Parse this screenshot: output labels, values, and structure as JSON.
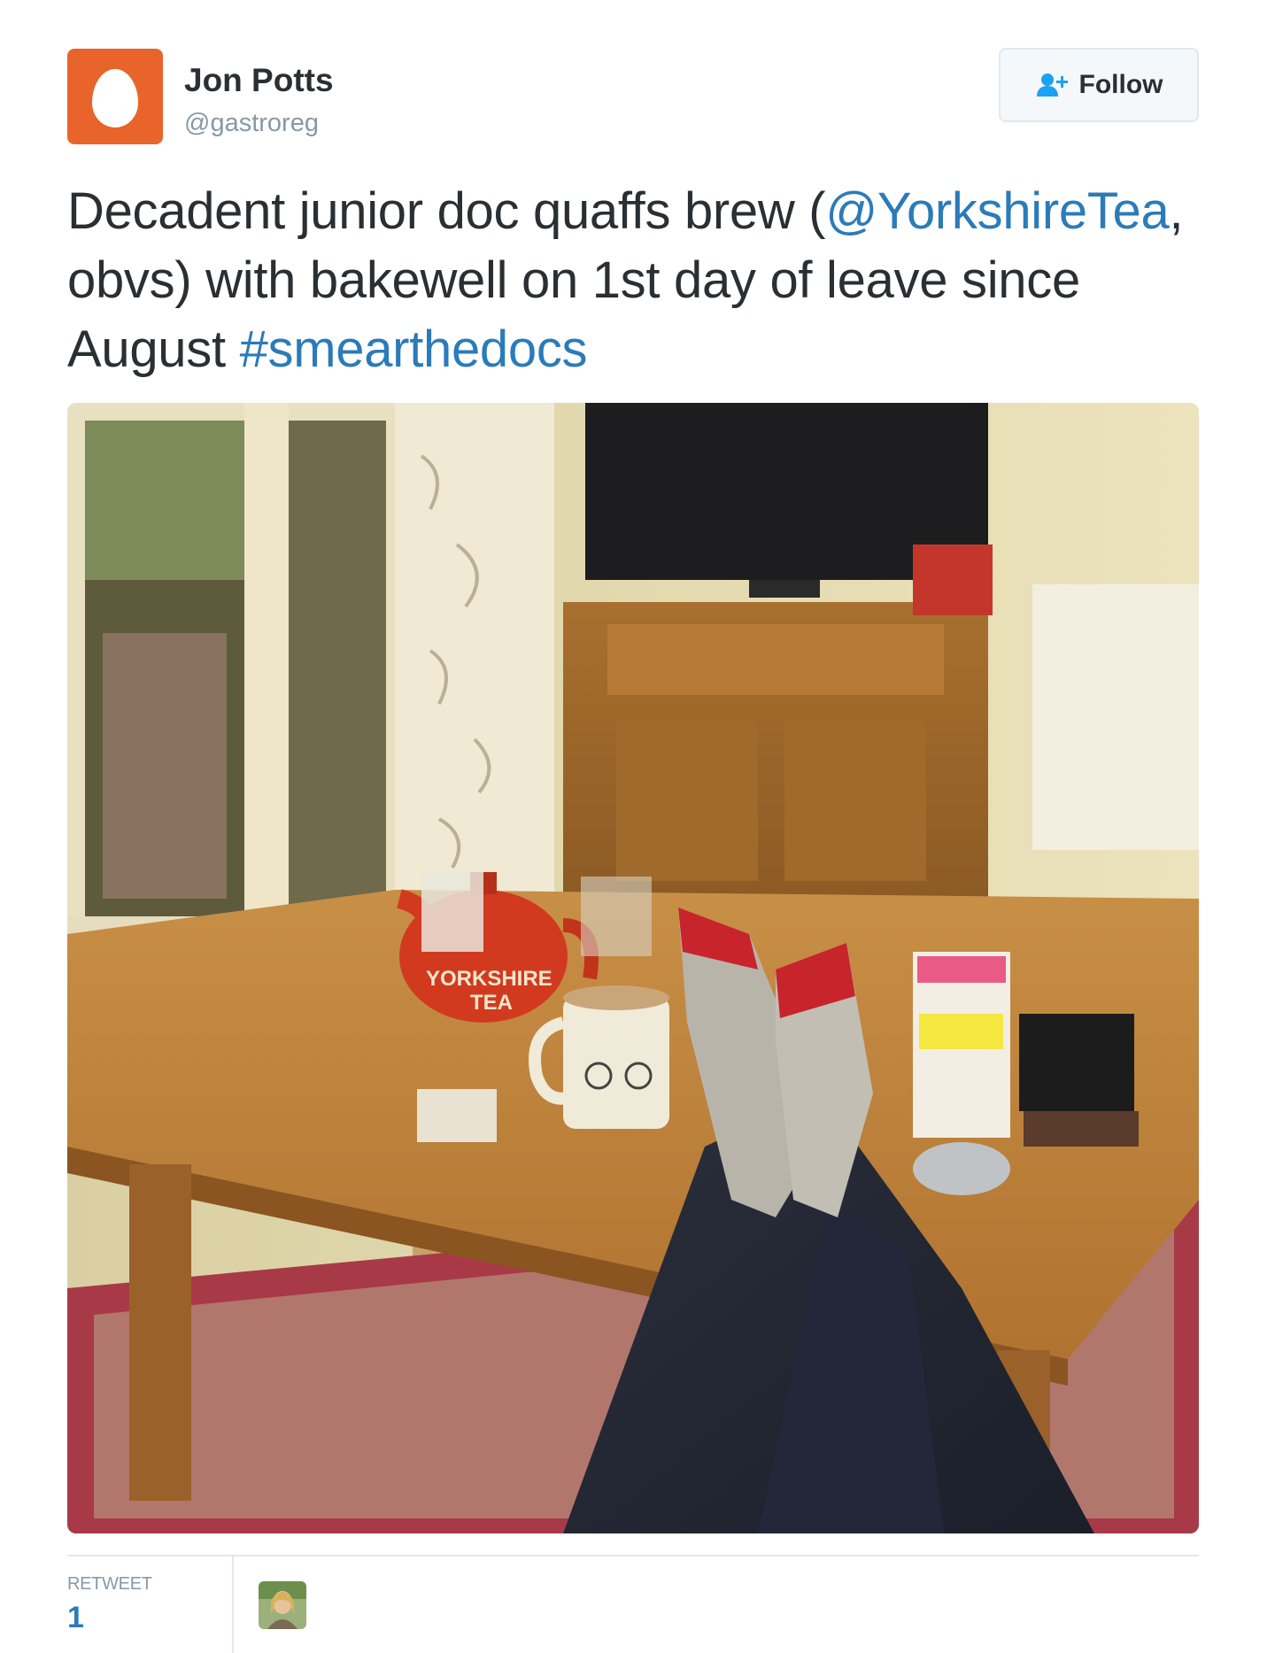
{
  "author": {
    "name": "Jon Potts",
    "handle": "@gastroreg",
    "avatar_color": "#e8642b"
  },
  "follow_button": {
    "label": "Follow",
    "icon": "add-user-icon"
  },
  "tweet": {
    "text_segments": [
      {
        "text": "Decadent junior doc quaffs brew (",
        "type": "text"
      },
      {
        "text": "@YorkshireTea",
        "type": "mention"
      },
      {
        "text": ", obvs) with bakewell on 1st day of leave since August ",
        "type": "text"
      },
      {
        "text": "#smearthedocs",
        "type": "hashtag"
      }
    ],
    "link_color": "#2b7bb9"
  },
  "media": {
    "teapot_label_line1": "YORKSHIRE",
    "teapot_label_line2": "TEA"
  },
  "stats": {
    "retweet_label": "RETWEET",
    "retweet_count": "1"
  }
}
